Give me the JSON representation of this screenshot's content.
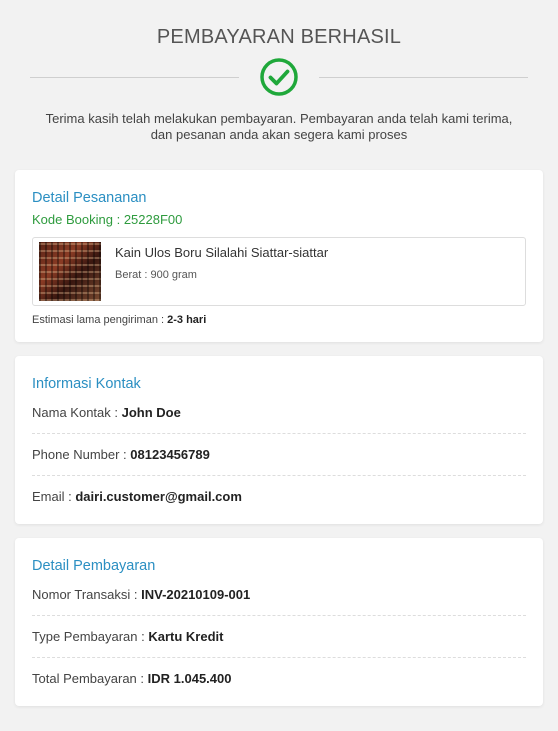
{
  "header": {
    "title": "PEMBAYARAN BERHASIL",
    "message": "Terima kasih telah melakukan pembayaran. Pembayaran anda telah kami terima, dan pesanan anda akan segera kami proses",
    "success_color": "#1fa83a",
    "icon": "check-circle-icon"
  },
  "order": {
    "title": "Detail Pesananan",
    "booking_label": "Kode Booking :",
    "booking_code": "25228F00",
    "product_name": "Kain Ulos Boru Silalahi Siattar-siattar",
    "product_weight": "Berat : 900 gram",
    "estimate_label": "Estimasi lama pengiriman :",
    "estimate_value": "2-3 hari"
  },
  "contact": {
    "title": "Informasi Kontak",
    "name_label": "Nama Kontak :",
    "name_value": "John Doe",
    "phone_label": "Phone Number :",
    "phone_value": "08123456789",
    "email_label": "Email :",
    "email_value": "dairi.customer@gmail.com"
  },
  "payment": {
    "title": "Detail Pembayaran",
    "trx_label": "Nomor Transaksi :",
    "trx_value": "INV-20210109-001",
    "type_label": "Type Pembayaran :",
    "type_value": "Kartu Kredit",
    "total_label": "Total Pembayaran :",
    "total_value": "IDR 1.045.400"
  }
}
